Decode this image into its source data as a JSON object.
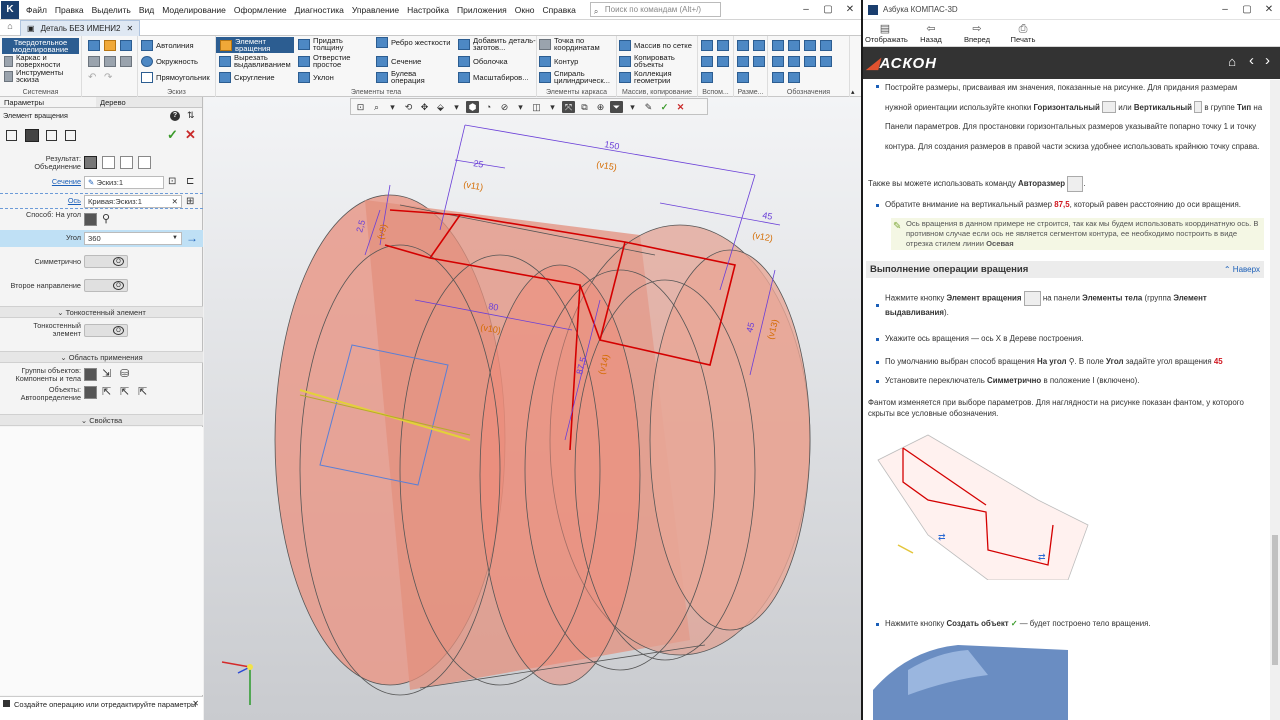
{
  "app": {
    "menu": [
      "Файл",
      "Правка",
      "Выделить",
      "Вид",
      "Моделирование",
      "Оформление",
      "Диагностика",
      "Управление",
      "Настройка",
      "Приложения",
      "Окно",
      "Справка"
    ],
    "search_placeholder": "Поиск по командам (Alt+/)",
    "doc_tab": "Деталь БЕЗ ИМЕНИ2",
    "ribbon": {
      "modes": [
        "Твердотельное моделирование",
        "Каркас и поверхности",
        "Инструменты эскиза"
      ],
      "sketch": [
        "Автолиния",
        "Окружность",
        "Прямоугольник"
      ],
      "body": [
        "Элемент вращения",
        "Вырезать выдавливанием",
        "Скругление",
        "Придать толщину",
        "Отверстие простое",
        "Уклон",
        "Ребро жесткости",
        "Сечение",
        "Булева операция",
        "Добавить деталь-заготов...",
        "Оболочка",
        "Масштабиров..."
      ],
      "frame": [
        "Точка по координатам",
        "Контур",
        "Спираль цилиндрическ..."
      ],
      "array": [
        "Массив по сетке",
        "Копировать объекты",
        "Коллекция геометрии"
      ],
      "group_labels": [
        "Системная",
        "Эскиз",
        "Элементы тела",
        "Элементы каркаса",
        "Массив, копирование",
        "Вспом...",
        "Разме...",
        "Обозначения"
      ]
    },
    "panel": {
      "tabs": [
        "Параметры",
        "Дерево"
      ],
      "title": "Элемент вращения",
      "result_label": "Результат: Объединение",
      "section_label": "Сечение",
      "section_value": "Эскиз:1",
      "axis_label": "Ось",
      "axis_value": "Кривая:Эскиз:1",
      "method_label": "Способ: На угол",
      "angle_label": "Угол",
      "angle_value": "360",
      "symmetric_label": "Симметрично",
      "second_dir_label": "Второе направление",
      "thin_wall_header": "Тонкостенный элемент",
      "thin_wall_label": "Тонкостенный элемент",
      "scope_header": "Область применения",
      "groups_label": "Группы объектов: Компоненты и тела",
      "objects_label": "Объекты: Автоопределение",
      "props_header": "Свойства",
      "status": "Создайте операцию или отредактируйте параметры"
    },
    "dims": {
      "d150": "150",
      "v15": "(v15)",
      "d25": "25",
      "v11": "(v11)",
      "d45": "45",
      "v12": "(v12)",
      "d2_5": "2,5",
      "v9": "(v9)",
      "d80": "80",
      "v10": "(v10)",
      "d87_5": "87,5",
      "v14": "(v14)",
      "d45b": "45",
      "v13": "(v13)"
    }
  },
  "help": {
    "title": "Азбука КОМПАС-3D",
    "toolbar": [
      "Отображать",
      "Назад",
      "Вперед",
      "Печать"
    ],
    "logo": "АСКОН",
    "p1a": "Постройте размеры, присваивая им значения, показанные на рисунке. Для придания размерам нужной ориентации используйте кнопки",
    "p1_horizontal": "Горизонтальный",
    "p1_or": "или",
    "p1_vertical": "Вертикальный",
    "p1_in_group": "в группе",
    "p1_type": "Тип",
    "p1b": "на Панели параметров. Для простановки горизонтальных размеров указывайте попарно точку 1 и точку контура. Для создания размеров в правой части эскиза удобнее использовать крайнюю точку справа.",
    "p2_pre": "Также вы можете использовать команду",
    "p2_cmd": "Авторазмер",
    "p3_pre": "Обратите внимание на вертикальный размер",
    "p3_val": "87,5",
    "p3_post": ", который равен расстоянию до оси вращения.",
    "note": "Ось вращения в данном примере не строится, так как мы будем использовать координатную ось. В противном случае если ось не является сегментом контура, ее необходимо построить в виде отрезка стилем линии",
    "note_bold": "Осевая",
    "section": "Выполнение операции вращения",
    "up": "Наверх",
    "b1_pre": "Нажмите кнопку",
    "b1_btn": "Элемент вращения",
    "b1_mid": "на панели",
    "b1_panel": "Элементы тела",
    "b1_grp": "(группа",
    "b1_grpname": "Элемент выдавливания",
    "b1_end": ").",
    "b2": "Укажите ось вращения — ось X в Дереве построения.",
    "b3_pre": "По умолчанию выбран способ вращения",
    "b3_m": "На угол",
    "b3_mid": ". В поле",
    "b3_f": "Угол",
    "b3_post": "задайте угол вращения",
    "b3_v": "45",
    "b4_pre": "Установите переключатель",
    "b4_s": "Симметрично",
    "b4_post": "в положение I (включено).",
    "p4": "Фантом изменяется при выборе параметров. Для наглядности на рисунке показан фантом, у которого скрыты все условные обозначения.",
    "b5_pre": "Нажмите кнопку",
    "b5_btn": "Создать объект",
    "b5_post": "— будет построено тело вращения."
  }
}
